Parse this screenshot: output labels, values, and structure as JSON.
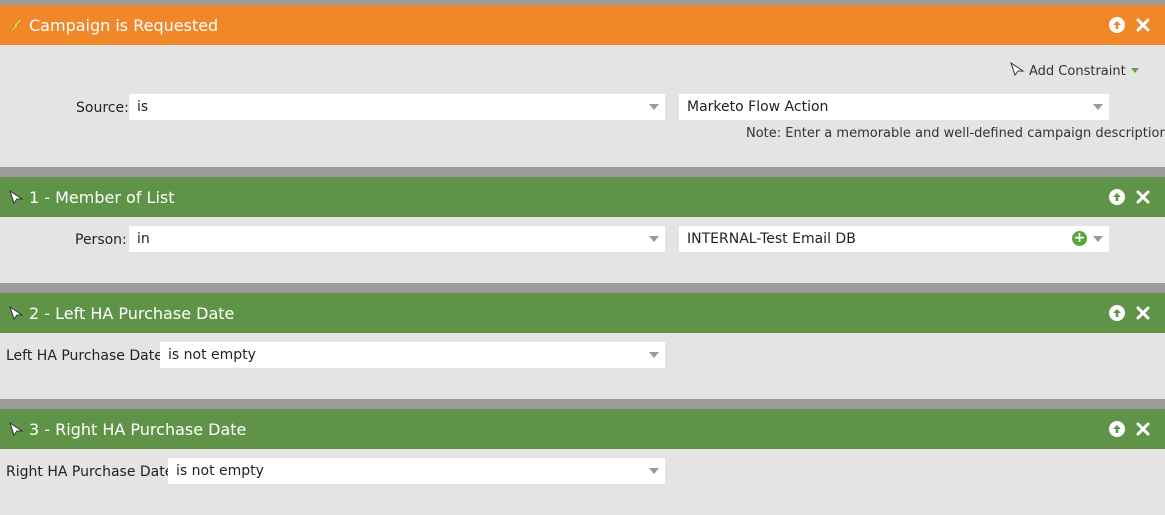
{
  "trigger": {
    "title": "Campaign is Requested",
    "add_constraint_label": "Add Constraint",
    "source_label": "Source:",
    "source_operator": "is",
    "source_value": "Marketo Flow Action",
    "note": "Note: Enter a memorable and well-defined campaign description",
    "colors": {
      "header": "#f0882a"
    }
  },
  "filters": [
    {
      "title": "1 - Member of List",
      "field_label": "Person:",
      "operator": "in",
      "value": "INTERNAL-Test Email DB"
    },
    {
      "title": "2 - Left HA Purchase Date",
      "field_label": "Left HA Purchase Date:",
      "operator": "is not empty"
    },
    {
      "title": "3 - Right HA Purchase Date",
      "field_label": "Right HA Purchase Date:",
      "operator": "is not empty"
    }
  ],
  "colors": {
    "filter_header": "#5f9448",
    "body": "#e4e4e4",
    "separator": "#9b9b9b"
  }
}
